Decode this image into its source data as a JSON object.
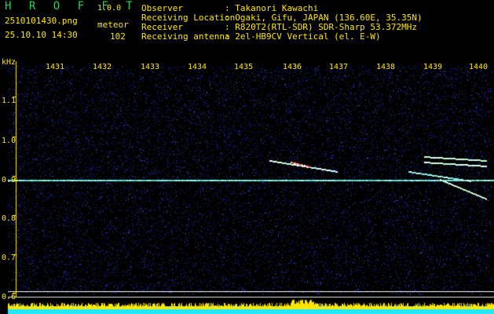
{
  "header": {
    "brand": "H R O F F T",
    "version": "1.0.0",
    "filename": "2510101430.png",
    "datetime": "25.10.10 14:30",
    "mode": "meteor",
    "count": "102"
  },
  "info": [
    {
      "key": "Observer",
      "value": ": Takanori Kawachi"
    },
    {
      "key": "Receiving Location",
      "value": ": Ogaki, Gifu, JAPAN (136.60E, 35.35N)"
    },
    {
      "key": "Receiver",
      "value": ": R820T2(RTL-SDR) SDR-Sharp 53.372MHz"
    },
    {
      "key": "Receiving antenna",
      "value": ": 2el-HB9CV Vertical (el. E-W)"
    }
  ],
  "axis": {
    "unit": "kHz",
    "x_ticks": [
      "1431",
      "1432",
      "1433",
      "1434",
      "1435",
      "1436",
      "1437",
      "1438",
      "1439",
      "1440"
    ],
    "y_ticks": [
      "1.1",
      "1.0",
      "0.9",
      "0.8",
      "0.7",
      "0.6"
    ]
  },
  "colors": {
    "text": "#ffe600",
    "brand": "#2bd14a",
    "signal": "#8fffd0",
    "noise": "#1b2aa0"
  }
}
